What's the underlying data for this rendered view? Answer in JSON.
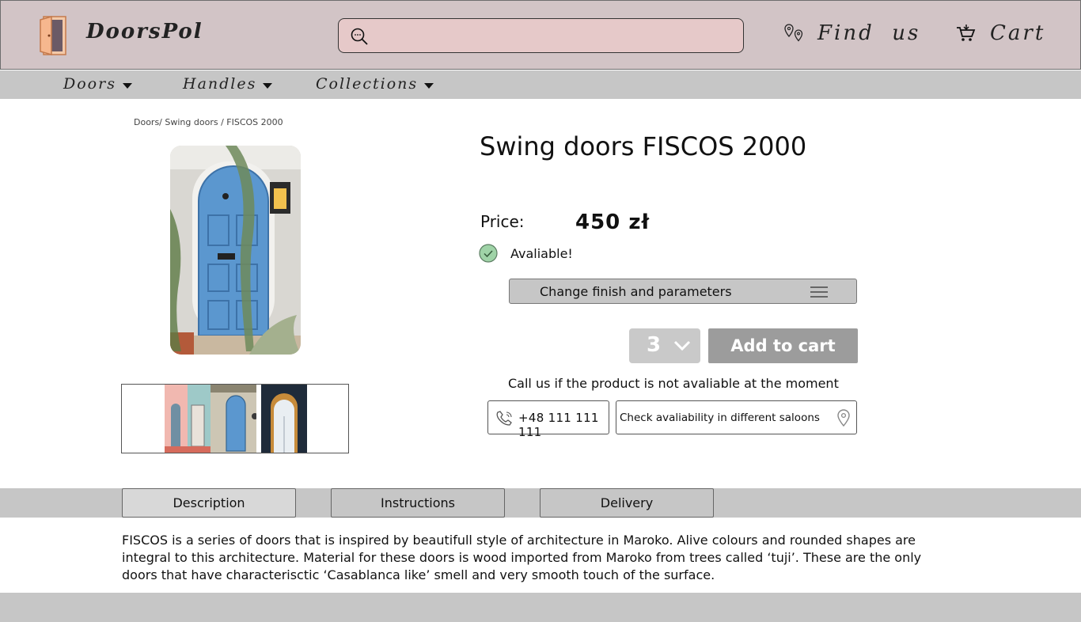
{
  "brand": {
    "name": "DoorsPol",
    "logo_icon": "door-icon"
  },
  "search": {
    "placeholder": "",
    "value": ""
  },
  "header_links": {
    "find_us": "Find  us",
    "cart": "Cart"
  },
  "nav": {
    "items": [
      {
        "label": "Doors"
      },
      {
        "label": "Handles"
      },
      {
        "label": "Collections"
      }
    ]
  },
  "breadcrumb": "Doors/ Swing doors / FISCOS 2000",
  "product": {
    "title": "Swing doors FISCOS 2000",
    "price_label": "Price:",
    "price": "450 zł",
    "availability": "Avaliable!",
    "change_finish": "Change finish and parameters",
    "quantity": "3",
    "add_to_cart": "Add to cart",
    "call_text": "Call us if the product is not avaliable at the moment",
    "phone": "+48 111 111 111",
    "check_availability": "Check avaliability in different saloons"
  },
  "tabs": [
    {
      "label": "Description",
      "active": true
    },
    {
      "label": "Instructions",
      "active": false
    },
    {
      "label": "Delivery",
      "active": false
    }
  ],
  "description": "FISCOS is a series of doors that is inspired by beautifull style of architecture in Maroko. Alive colours and rounded shapes are integral to this architecture. Material for these doors is wood imported from Maroko from trees called ‘tuji’. These are the only doors that have characterisctic ‘Casablanca like’ smell and very smooth touch of the surface.",
  "colors": {
    "header_bg": "#d2c4c6",
    "search_bg": "#e6c9c9",
    "bar_grey": "#c6c6c6",
    "button_grey": "#9c9c9c",
    "door_blue": "#5b97cf"
  }
}
